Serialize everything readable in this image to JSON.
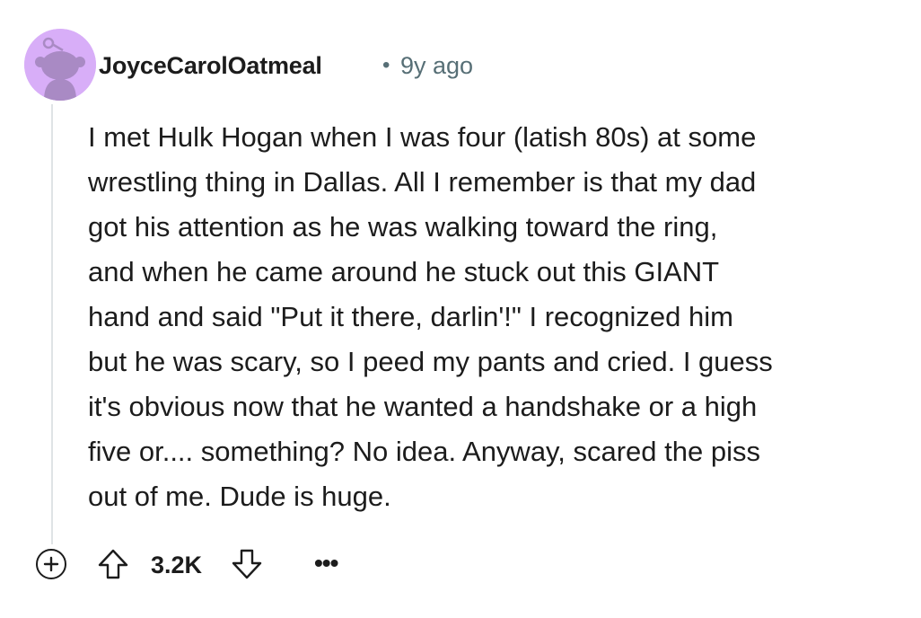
{
  "comment": {
    "author": "JoyceCarolOatmeal",
    "separator": "•",
    "timestamp": "9y ago",
    "avatar_icon": "snoo-avatar-icon",
    "avatar_color": "#d8aef8",
    "body": "I met Hulk Hogan when I was four (latish 80s) at some\nwrestling thing in Dallas. All I remember is that my dad\ngot his attention as he was walking toward the ring,\nand when he came around he stuck out this GIANT\nhand and said \"Put it there, darlin'!\" I recognized him\nbut he was scary, so I peed my pants and cried. I guess\nit's obvious now that he wanted a handshake or a high\nfive or.... something? No idea. Anyway, scared the piss\nout of me. Dude is huge.",
    "actions": {
      "expand_icon": "plus-circle-icon",
      "upvote_icon": "upvote-arrow-icon",
      "score": "3.2K",
      "downvote_icon": "downvote-arrow-icon",
      "more_label": "•••"
    }
  }
}
